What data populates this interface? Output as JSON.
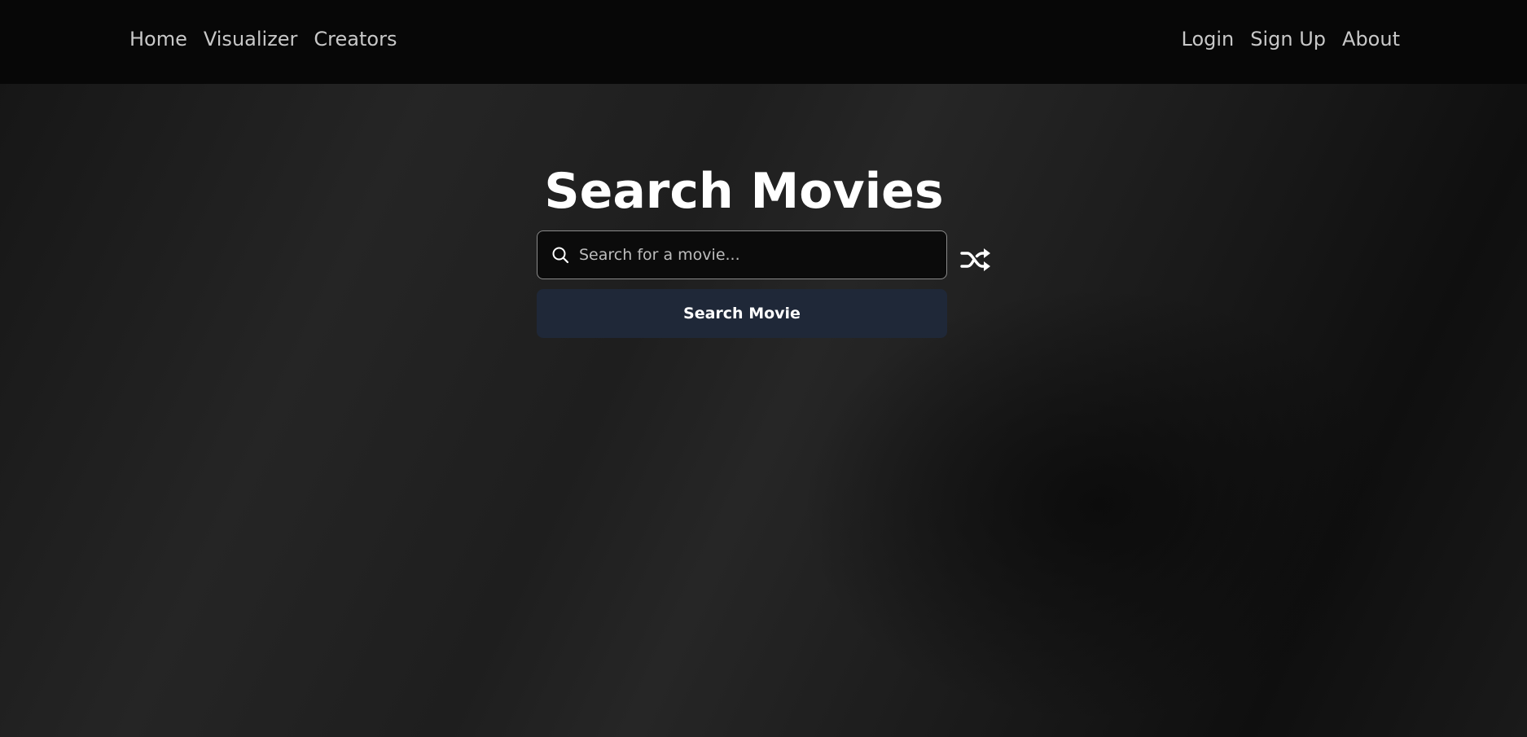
{
  "nav": {
    "left": [
      "Home",
      "Visualizer",
      "Creators"
    ],
    "right": [
      "Login",
      "Sign Up",
      "About"
    ]
  },
  "main": {
    "title": "Search Movies",
    "search": {
      "placeholder": "Search for a movie...",
      "value": ""
    },
    "search_button_label": "Search Movie",
    "icons": {
      "search": "search-icon",
      "shuffle": "shuffle-icon"
    }
  },
  "colors": {
    "navbar_bg": "#070707",
    "button_bg": "#1f2838",
    "input_border": "#8a8a8a",
    "nav_text": "#c8c8c8"
  }
}
